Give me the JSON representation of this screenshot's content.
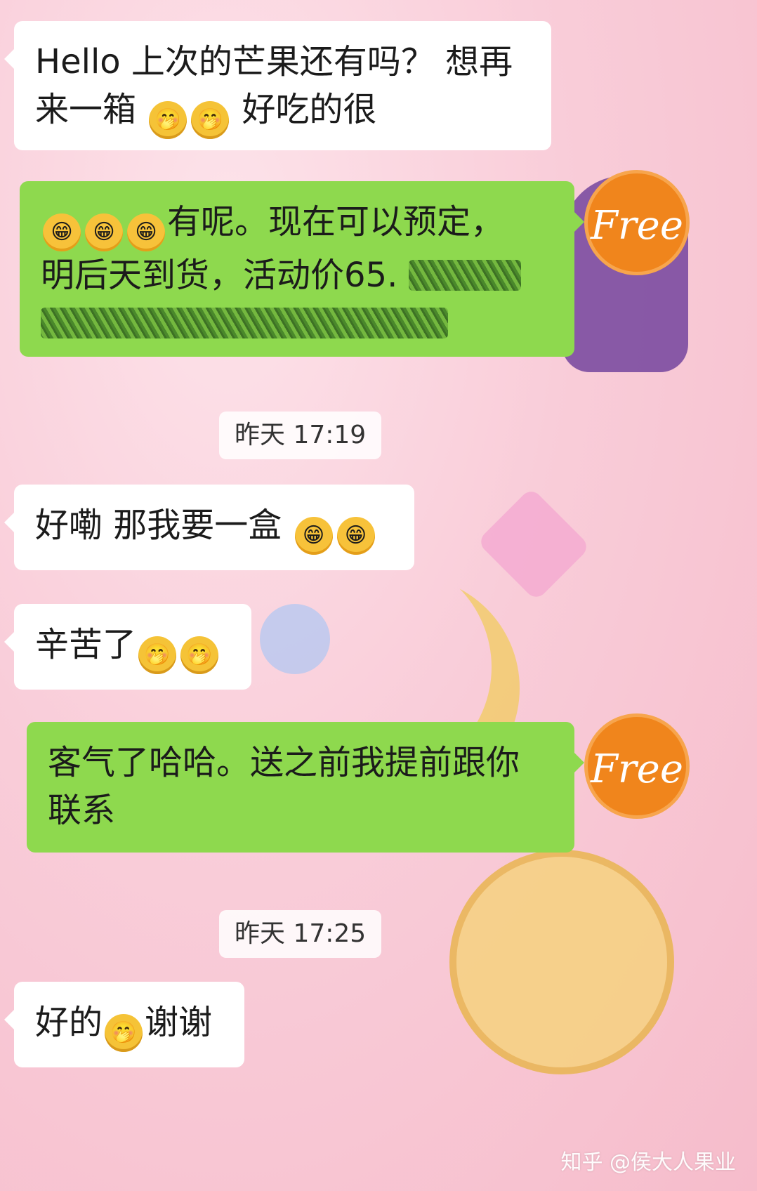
{
  "messages": [
    {
      "side": "left",
      "parts": [
        "Hello 上次的芒果还有吗？ 想再",
        "来一箱",
        "好吃的很"
      ]
    },
    {
      "side": "right",
      "parts": [
        "有呢。现在可以预定，",
        "明后天到货，活动价65."
      ]
    },
    {
      "side": "left",
      "parts": [
        "好嘞 那我要一盒"
      ]
    },
    {
      "side": "left",
      "parts": [
        "辛苦了"
      ]
    },
    {
      "side": "right",
      "parts": [
        "客气了哈哈。送之前我提前跟你",
        "联系"
      ]
    },
    {
      "side": "left",
      "parts": [
        "好的",
        "谢谢"
      ]
    }
  ],
  "timestamps": [
    "昨天 17:19",
    "昨天 17:25"
  ],
  "avatar_text": "Free",
  "watermark": "知乎 @侯大人果业",
  "icons": {
    "grin": "grinning-face-emoji",
    "think": "thinking-face-emoji"
  },
  "colors": {
    "left_bubble": "#ffffff",
    "right_bubble": "#8ed94e",
    "avatar": "#f0851c"
  }
}
